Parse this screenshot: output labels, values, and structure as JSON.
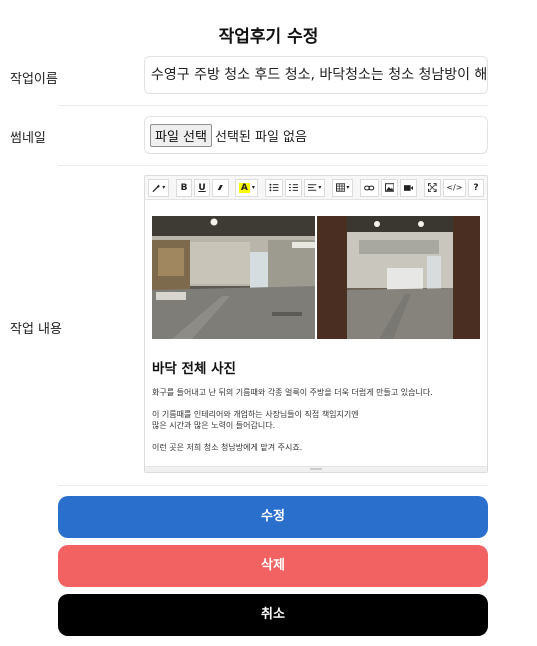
{
  "page": {
    "title": "작업후기 수정"
  },
  "form": {
    "name_label": "작업이름",
    "name_value": "수영구 주방 청소 후드 청소, 바닥청소는 청소 청남방이 해주",
    "thumb_label": "썸네일",
    "file_button": "파일 선택",
    "file_status": "선택된 파일 없음",
    "content_label": "작업 내용"
  },
  "editor": {
    "toolbar": {
      "magic": "magic-icon",
      "bold": "B",
      "underline": "U",
      "eraser": "eraser-icon",
      "font_color": "A",
      "bullet_list": "bullet-list-icon",
      "ordered_list": "ordered-list-icon",
      "align": "align-icon",
      "table": "table-icon",
      "link": "link-icon",
      "picture": "picture-icon",
      "video": "video-icon",
      "fullscreen": "fullscreen-icon",
      "code": "</>",
      "help": "?"
    },
    "heading": "바닥 전체 사진",
    "paragraphs": [
      "화구를 들어내고 난 뒤의 기름때와 각종 얼룩이 주방을 더욱 더럽게 만들고 있습니다.",
      "이 기름때를 인테리어와 개업하는 사장님들이 직접 책임지기엔",
      "많은 시간과 많은 노력이 들어갑니다.",
      "이런 곳은 저희 청소 청남방에게 맡겨 주시죠."
    ]
  },
  "actions": {
    "edit": "수정",
    "delete": "삭제",
    "cancel": "취소"
  },
  "colors": {
    "edit": "#2a6fcc",
    "delete": "#f26262",
    "cancel": "#000000",
    "highlight": "#ffff00"
  }
}
